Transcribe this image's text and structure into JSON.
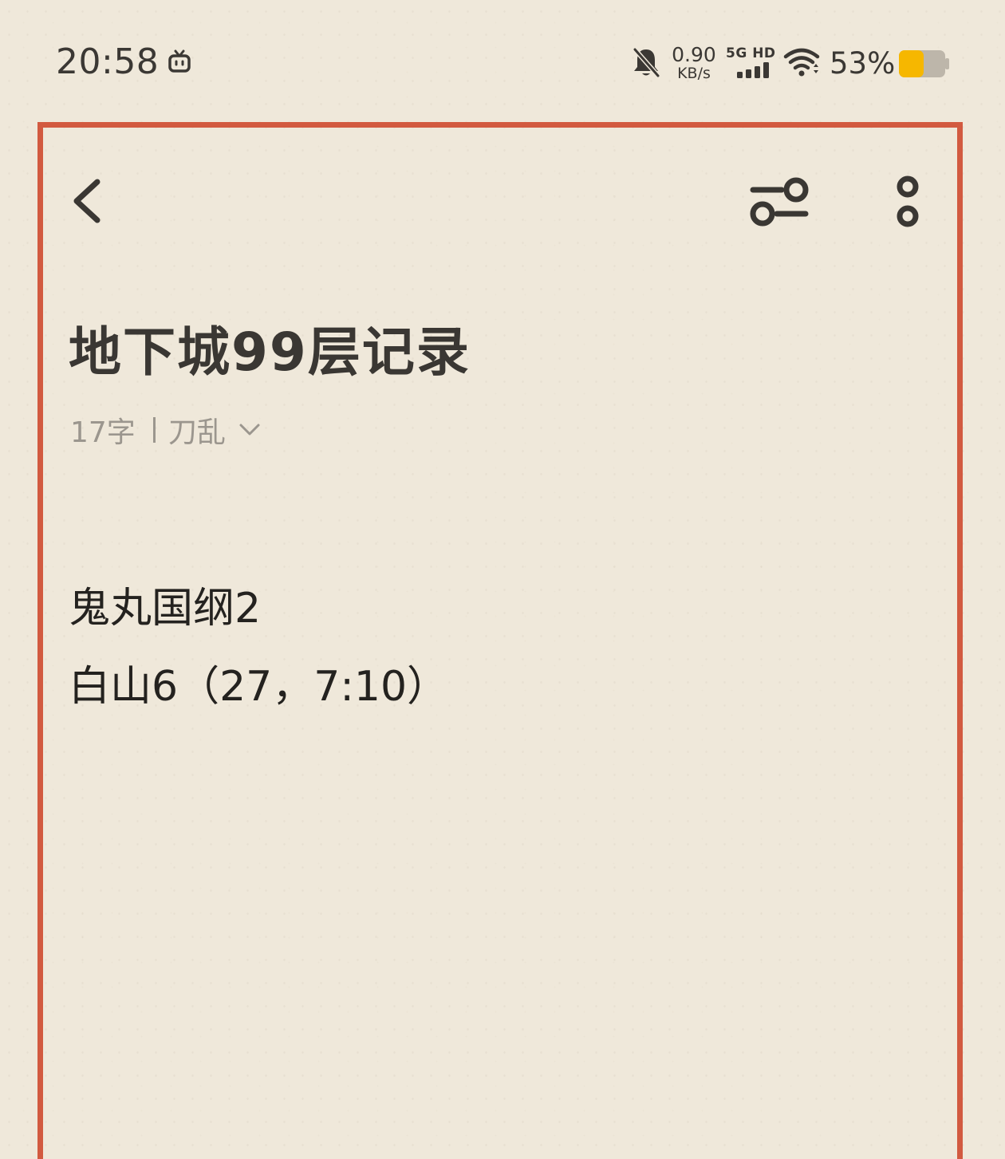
{
  "status_bar": {
    "time": "20:58",
    "net_speed_value": "0.90",
    "net_speed_unit": "KB/s",
    "network_type": "5G HD",
    "battery_percent": "53%",
    "battery_level": 0.53,
    "battery_color": "#f6b700"
  },
  "toolbar": {
    "back_icon": "chevron-left-icon",
    "filter_icon": "sliders-icon",
    "more_icon": "more-vertical-icon"
  },
  "note": {
    "title": "地下城99层记录",
    "word_count": "17字",
    "category": "刀乱",
    "lines": [
      "鬼丸国纲2",
      "白山6（27，7:10）"
    ]
  },
  "theme": {
    "frame_color": "#d25a40",
    "paper_color": "#efe8da"
  }
}
